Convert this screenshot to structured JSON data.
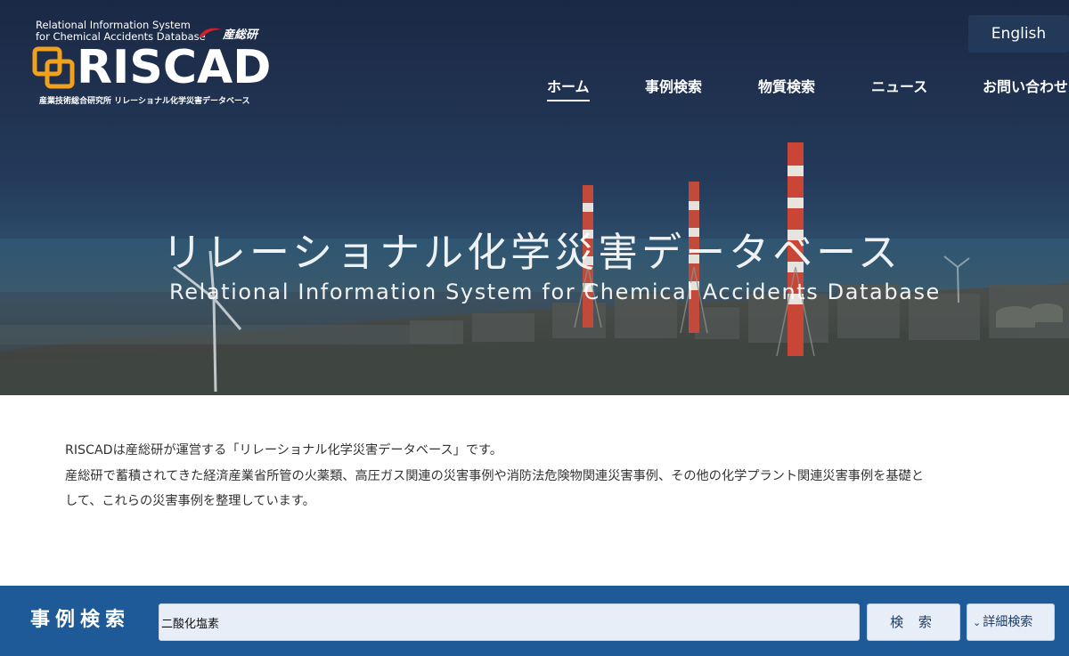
{
  "header": {
    "logo": {
      "english_line1": "Relational Information System",
      "english_line2": "for Chemical Accidents Database",
      "aist_mark": "産総研",
      "name": "RISCAD",
      "subtitle": "産業技術総合研究所 リレーショナル化学災害データベース"
    },
    "language_button": "English",
    "nav": [
      {
        "label": "ホーム",
        "active": true
      },
      {
        "label": "事例検索",
        "active": false
      },
      {
        "label": "物質検索",
        "active": false
      },
      {
        "label": "ニュース",
        "active": false
      },
      {
        "label": "お問い合わせ",
        "active": false
      }
    ]
  },
  "hero": {
    "title_ja": "リレーショナル化学災害データベース",
    "title_en": "Relational Information System for Chemical Accidents Database"
  },
  "intro": {
    "line1": "RISCADは産総研が運営する「リレーショナル化学災害データベース」です。",
    "line2": "産総研で蓄積されてきた経済産業省所管の火薬類、高圧ガス関連の災害事例や消防法危険物関連災害事例、その他の化学プラント関連災害事例を基礎と",
    "line3": "して、これらの災害事例を整理しています。"
  },
  "search": {
    "title": "事例検索",
    "input_value": "二酸化塩素",
    "search_button": "検 索",
    "advanced_button": "詳細検索",
    "advanced_icon": "chevron-down-icon"
  },
  "colors": {
    "hero_dark": "#1b2a44",
    "search_bar": "#1f5a98",
    "language_button_bg": "#22395a",
    "logo_accent": "#f2a11f",
    "aist_red": "#d42027"
  }
}
